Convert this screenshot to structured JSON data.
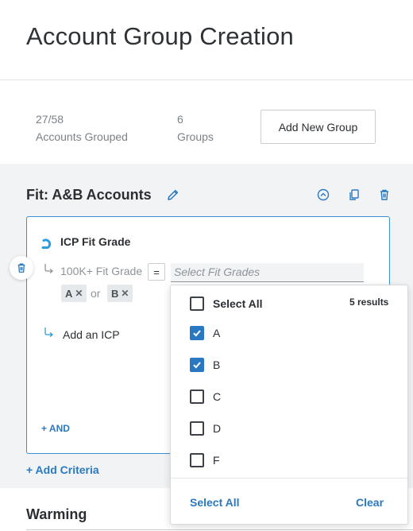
{
  "header": {
    "title": "Account Group Creation"
  },
  "stats": {
    "grouped_value": "27/58",
    "grouped_label": "Accounts Grouped",
    "groups_value": "6",
    "groups_label": "Groups",
    "add_group_label": "Add New Group"
  },
  "group": {
    "title": "Fit: A&B Accounts",
    "criteria": {
      "icp_title": "ICP Fit Grade",
      "criterion_label": "100K+ Fit Grade",
      "operator": "=",
      "select_placeholder": "Select Fit Grades",
      "chips": [
        "A",
        "B"
      ],
      "chip_remove": "✕",
      "or_label": "or",
      "add_icp_label": "Add an ICP",
      "and_label": "+ AND"
    },
    "add_criteria_label": "+ Add Criteria"
  },
  "dropdown": {
    "select_all_label": "Select All",
    "results_label": "5 results",
    "options": [
      {
        "label": "A",
        "checked": true
      },
      {
        "label": "B",
        "checked": true
      },
      {
        "label": "C",
        "checked": false
      },
      {
        "label": "D",
        "checked": false
      },
      {
        "label": "F",
        "checked": false
      }
    ],
    "footer_select_all": "Select All",
    "footer_clear": "Clear"
  },
  "next_group": {
    "title": "Warming"
  },
  "colors": {
    "accent": "#2a79c0",
    "card_border": "#3a8fd6",
    "background": "#f1f3f5"
  }
}
